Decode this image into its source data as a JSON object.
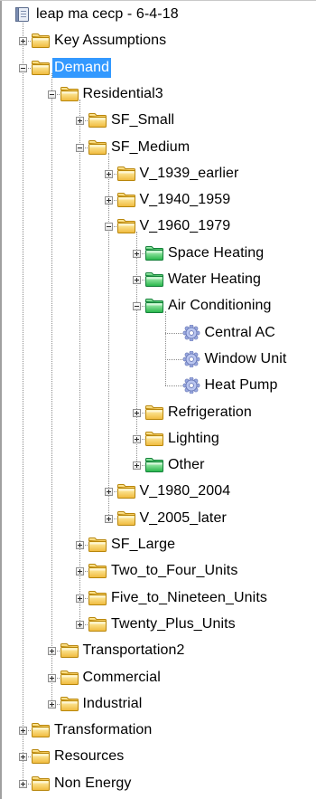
{
  "tree": {
    "root_label": "leap ma cecp - 6-4-18",
    "nodes": {
      "key_assumptions": "Key Assumptions",
      "demand": "Demand",
      "residential3": "Residential3",
      "sf_small": "SF_Small",
      "sf_medium": "SF_Medium",
      "v_1939_earlier": "V_1939_earlier",
      "v_1940_1959": "V_1940_1959",
      "v_1960_1979": "V_1960_1979",
      "space_heating": "Space Heating",
      "water_heating": "Water Heating",
      "air_conditioning": "Air Conditioning",
      "central_ac": "Central AC",
      "window_unit": "Window Unit",
      "heat_pump": "Heat Pump",
      "refrigeration": "Refrigeration",
      "lighting": "Lighting",
      "other": "Other",
      "v_1980_2004": "V_1980_2004",
      "v_2005_later": "V_2005_later",
      "sf_large": "SF_Large",
      "two_to_four_units": "Two_to_Four_Units",
      "five_to_nineteen_units": "Five_to_Nineteen_Units",
      "twenty_plus_units": "Twenty_Plus_Units",
      "transportation2": "Transportation2",
      "commercial": "Commercial",
      "industrial": "Industrial",
      "transformation": "Transformation",
      "resources": "Resources",
      "non_energy": "Non Energy"
    },
    "selected_node": "Demand",
    "icon_names": {
      "root": "book-icon",
      "category": "folder-icon",
      "end_use": "green-folder-icon",
      "device": "gear-icon"
    },
    "colors": {
      "selection": "#3399ff",
      "folder": "#f2c94c",
      "green_folder": "#33cc55",
      "gear": "#8a9bd6"
    }
  }
}
